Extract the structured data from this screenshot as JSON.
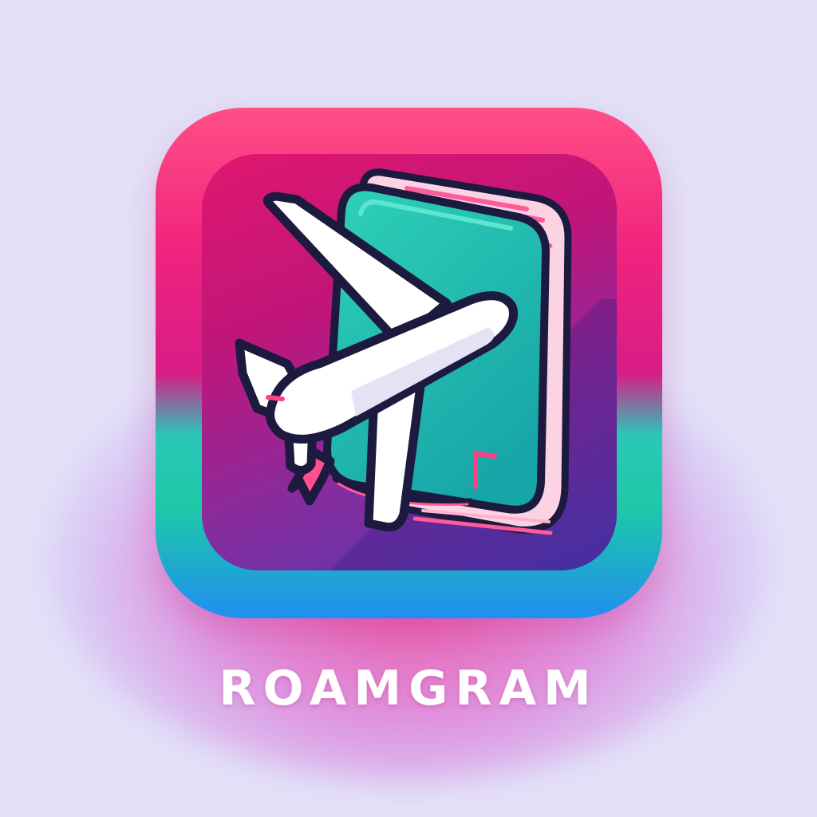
{
  "brand": {
    "name": "ROAMGRAM"
  },
  "logo": {
    "icons": [
      "airplane-icon",
      "passport-icon"
    ]
  },
  "colors": {
    "background": "#e3e1f8",
    "frame_top": "#ff4f86",
    "frame_bottom": "#1f8ff0",
    "frame_mid_teal": "#1ec9a6",
    "inner_top": "#e0176f",
    "inner_bottom": "#4d3bb2",
    "passport": "#1db9ad",
    "airplane": "#ffffff",
    "outline": "#1c1a3e",
    "accent_pink": "#ff4f91"
  }
}
